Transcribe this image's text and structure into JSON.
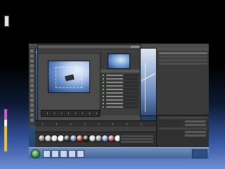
{
  "slide": {
    "accent_colors": [
      "#d65cc4",
      "#ffffff",
      "#f0c23a"
    ]
  },
  "app": {
    "menu_item_count": 12,
    "materials": [
      "#7a7a7a",
      "#bdbdbd",
      "#e0e0e0",
      "#ffffff",
      "#3a3a3a",
      "#5b88c9",
      "#c0392b",
      "#1a1a1a",
      "#d4d4d4",
      "#8e8e8e",
      "#6f9bd8",
      "#b04a4a",
      "#f0f0f0"
    ]
  },
  "taskbar": {
    "icons": [
      "start-orb",
      "explorer-icon",
      "browser-icon",
      "folder-icon",
      "media-icon",
      "app-icon"
    ]
  }
}
